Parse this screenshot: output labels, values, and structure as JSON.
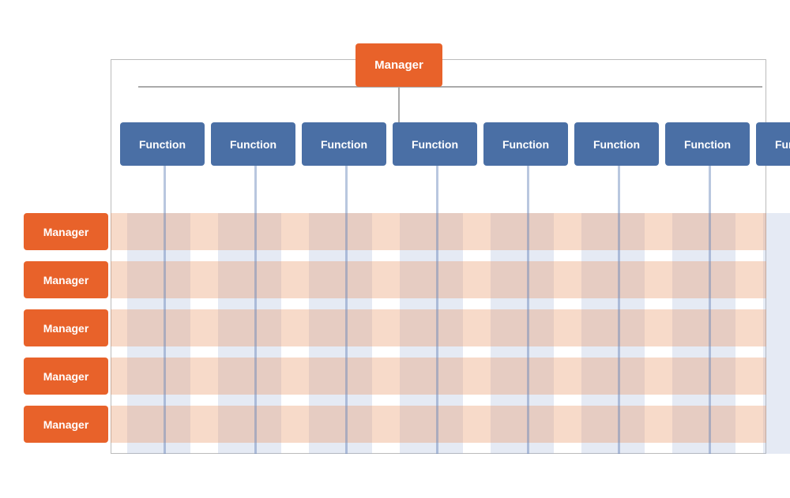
{
  "manager_top": {
    "label": "Manager"
  },
  "functions": [
    {
      "label": "Function"
    },
    {
      "label": "Function"
    },
    {
      "label": "Function"
    },
    {
      "label": "Function"
    },
    {
      "label": "Function"
    },
    {
      "label": "Function"
    },
    {
      "label": "Function"
    },
    {
      "label": "Function"
    }
  ],
  "managers": [
    {
      "label": "Manager"
    },
    {
      "label": "Manager"
    },
    {
      "label": "Manager"
    },
    {
      "label": "Manager"
    },
    {
      "label": "Manager"
    }
  ],
  "colors": {
    "orange": "#e8622a",
    "blue": "#4a6fa5",
    "white": "#ffffff"
  }
}
